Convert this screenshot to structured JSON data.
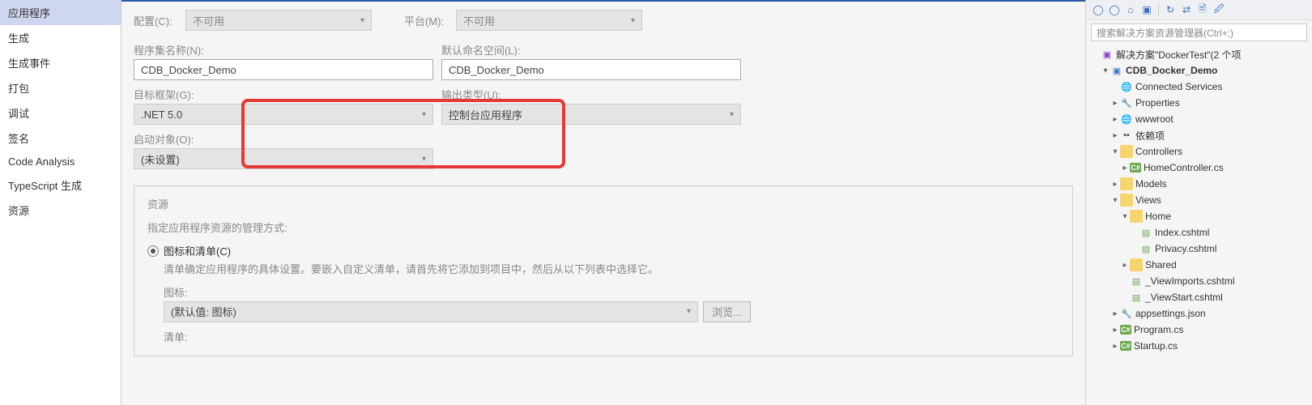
{
  "leftTabs": [
    {
      "label": "应用程序",
      "selected": true
    },
    {
      "label": "生成",
      "selected": false
    },
    {
      "label": "生成事件",
      "selected": false
    },
    {
      "label": "打包",
      "selected": false
    },
    {
      "label": "调试",
      "selected": false
    },
    {
      "label": "签名",
      "selected": false
    },
    {
      "label": "Code Analysis",
      "selected": false
    },
    {
      "label": "TypeScript 生成",
      "selected": false
    },
    {
      "label": "资源",
      "selected": false
    }
  ],
  "config": {
    "label": "配置(C):",
    "value": "不可用"
  },
  "platform": {
    "label": "平台(M):",
    "value": "不可用"
  },
  "assemblyName": {
    "label": "程序集名称(N):",
    "value": "CDB_Docker_Demo"
  },
  "defaultNamespace": {
    "label": "默认命名空间(L):",
    "value": "CDB_Docker_Demo"
  },
  "targetFramework": {
    "label": "目标框架(G):",
    "value": ".NET 5.0"
  },
  "outputType": {
    "label": "输出类型(U):",
    "value": "控制台应用程序"
  },
  "startup": {
    "label": "启动对象(O):",
    "value": "(未设置)"
  },
  "resources": {
    "title": "资源",
    "subtitle": "指定应用程序资源的管理方式:",
    "radio": "图标和清单(C)",
    "help": "清单确定应用程序的具体设置。要嵌入自定义清单，请首先将它添加到项目中，然后从以下列表中选择它。",
    "iconLabel": "图标:",
    "iconValue": "(默认值: 图标)",
    "browse": "浏览...",
    "manifestLabel": "清单:"
  },
  "search": {
    "placeholder": "搜索解决方案资源管理器(Ctrl+;)"
  },
  "solution": {
    "label": "解决方案\"DockerTest\"(2 个项"
  },
  "tree": [
    {
      "indent": 1,
      "arrow": "open",
      "icon": "proj",
      "label": "CDB_Docker_Demo",
      "bold": true
    },
    {
      "indent": 2,
      "arrow": "none",
      "icon": "globe",
      "label": "Connected Services"
    },
    {
      "indent": 2,
      "arrow": "closed",
      "icon": "wrench",
      "label": "Properties"
    },
    {
      "indent": 2,
      "arrow": "closed",
      "icon": "globe",
      "label": "wwwroot"
    },
    {
      "indent": 2,
      "arrow": "closed",
      "icon": "ref",
      "label": "依赖项"
    },
    {
      "indent": 2,
      "arrow": "open",
      "icon": "folder",
      "label": "Controllers"
    },
    {
      "indent": 3,
      "arrow": "closed",
      "icon": "csharp",
      "label": "HomeController.cs"
    },
    {
      "indent": 2,
      "arrow": "closed",
      "icon": "folder",
      "label": "Models"
    },
    {
      "indent": 2,
      "arrow": "open",
      "icon": "folder",
      "label": "Views"
    },
    {
      "indent": 3,
      "arrow": "open",
      "icon": "folder",
      "label": "Home"
    },
    {
      "indent": 4,
      "arrow": "none",
      "icon": "file",
      "label": "Index.cshtml"
    },
    {
      "indent": 4,
      "arrow": "none",
      "icon": "file",
      "label": "Privacy.cshtml"
    },
    {
      "indent": 3,
      "arrow": "closed",
      "icon": "folder",
      "label": "Shared"
    },
    {
      "indent": 3,
      "arrow": "none",
      "icon": "file",
      "label": "_ViewImports.cshtml"
    },
    {
      "indent": 3,
      "arrow": "none",
      "icon": "file",
      "label": "_ViewStart.cshtml"
    },
    {
      "indent": 2,
      "arrow": "closed",
      "icon": "json",
      "label": "appsettings.json"
    },
    {
      "indent": 2,
      "arrow": "closed",
      "icon": "csharp",
      "label": "Program.cs"
    },
    {
      "indent": 2,
      "arrow": "closed",
      "icon": "csharp",
      "label": "Startup.cs"
    }
  ]
}
